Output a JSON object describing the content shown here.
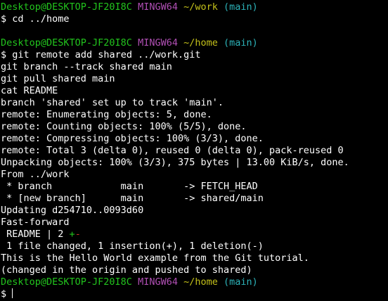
{
  "colors": {
    "background": "#000000",
    "text": "#ffffff",
    "user_host": "#22c41d",
    "shell": "#b04fb4",
    "path": "#c3c01a",
    "branch": "#2cb2b8",
    "diff_add": "#22c41d",
    "diff_del": "#cf2f2f"
  },
  "prompts": [
    {
      "user_host": "Desktop@DESKTOP-JF20I8C",
      "shell": "MINGW64",
      "path": "~/work",
      "branch": "(main)",
      "command": "cd ../home"
    },
    {
      "user_host": "Desktop@DESKTOP-JF20I8C",
      "shell": "MINGW64",
      "path": "~/home",
      "branch": "(main)",
      "command": "git remote add shared ../work.git"
    },
    {
      "user_host": "Desktop@DESKTOP-JF20I8C",
      "shell": "MINGW64",
      "path": "~/home",
      "branch": "(main)",
      "command": ""
    }
  ],
  "prompt_symbol": "$",
  "output": [
    "git branch --track shared main",
    "git pull shared main",
    "cat README",
    "branch 'shared' set up to track 'main'.",
    "remote: Enumerating objects: 5, done.",
    "remote: Counting objects: 100% (5/5), done.",
    "remote: Compressing objects: 100% (3/3), done.",
    "remote: Total 3 (delta 0), reused 0 (delta 0), pack-reused 0",
    "Unpacking objects: 100% (3/3), 375 bytes | 13.00 KiB/s, done.",
    "From ../work",
    " * branch            main       -> FETCH_HEAD",
    " * [new branch]      main       -> shared/main",
    "Updating d254710..0093d60",
    "Fast-forward",
    " 1 file changed, 1 insertion(+), 1 deletion(-)",
    "This is the Hello World example from the Git tutorial.",
    "(changed in the origin and pushed to shared)"
  ],
  "diffstat": {
    "prefix": " README | 2 ",
    "plus": "+",
    "minus": "-"
  }
}
